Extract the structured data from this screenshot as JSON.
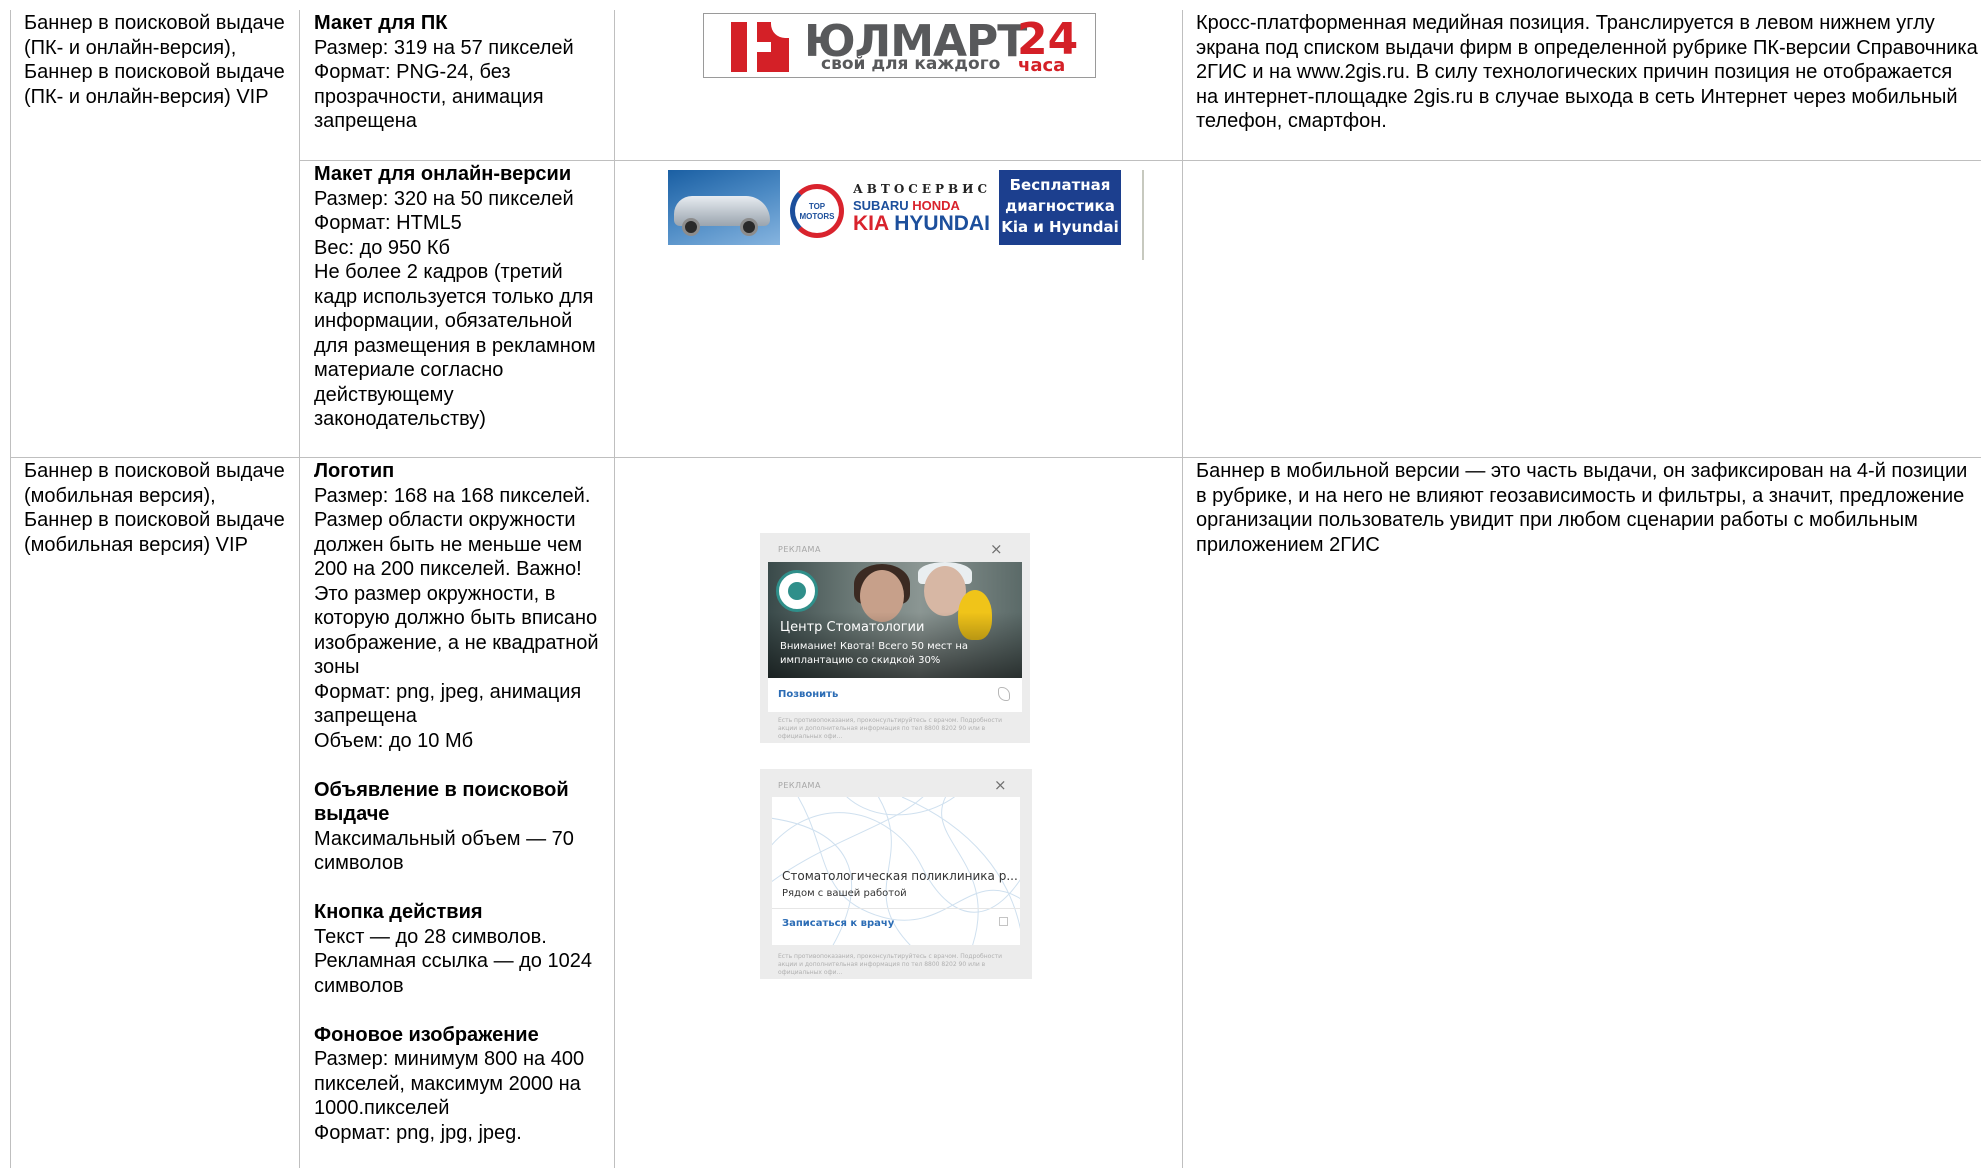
{
  "rows": [
    {
      "placement": "Баннер в поисковой выдаче (ПК- и онлайн-версия), Баннер в поисковой выдаче (ПК- и онлайн-версия) VIP",
      "specs": [
        {
          "title": "Макет для ПК",
          "lines": [
            "Размер: 319 на 57 пикселей",
            "Формат: PNG-24, без прозрачности, анимация запрещена"
          ],
          "banner": {
            "brand": "ЮЛМАРТ",
            "number": "24",
            "tagline": "свой для каждого",
            "tagline_suffix": "часа",
            "colors": {
              "brand_red": "#d42027",
              "brand_gray": "#58595b"
            }
          }
        },
        {
          "title": "Макет для онлайн-версии",
          "lines": [
            "Размер: 320 на 50 пикселей",
            "Формат: HTML5",
            "Вес: до 950 Кб",
            "Не более 2 кадров (третий кадр используется только для информации, обязательной для размещения в рекламном материале согласно действующему законодательству)"
          ],
          "banner": {
            "logo_text": "TOP MOTORS",
            "line1": "АВТОСЕРВИС",
            "brand_a": "SUBARU",
            "brand_b": "HONDA",
            "brand_c": "KIA",
            "brand_d": "HYUNDAI",
            "promo": [
              "Бесплатная",
              "диагностика",
              "Kia и Hyundai"
            ],
            "colors": {
              "blue": "#1c3f8e",
              "red": "#d9232d"
            }
          }
        }
      ],
      "description": "Кросс-платформенная медийная позиция. Транслируется в левом нижнем углу экрана под списком выдачи фирм в определенной рубрике ПК-версии Справочника 2ГИС и на www.2gis.ru. В силу технологических причин позиция не отображается на интернет-площадке 2gis.ru в случае выхода в сеть Интернет через мобильный телефон, смартфон."
    },
    {
      "placement": "Баннер в поисковой выдаче (мобильная версия), Баннер в поисковой выдаче (мобильная версия) VIP",
      "specs": [
        {
          "title": "Логотип",
          "lines": [
            "Размер: 168 на 168 пикселей. Размер области окружности должен быть не меньше чем 200 на 200 пикселей. Важно! Это размер окружности, в которую должно быть вписано изображение, а не квадратной зоны",
            "Формат: png, jpeg, анимация запрещена",
            "Объем: до 10 Мб"
          ]
        },
        {
          "title": "Объявление в поисковой выдаче",
          "lines": [
            "Максимальный объем — 70 символов"
          ]
        },
        {
          "title": "Кнопка действия",
          "lines": [
            "Текст — до 28 символов.",
            "Рекламная ссылка — до 1024 символов"
          ]
        },
        {
          "title": "Фоновое изображение",
          "lines": [
            "Размер: минимум 800 на 400 пикселей, максимум 2000 на 1000.пикселей",
            "Формат: png, jpg, jpeg."
          ]
        }
      ],
      "cards": [
        {
          "label": "РЕКЛАМА",
          "title": "Центр Стоматологии",
          "subtitle": "Внимание! Квота! Всего 50 мест на имплантацию со скидкой 30%",
          "action": "Позвонить",
          "fine_print": "Есть противопоказания, проконсультируйтесь с врачом. Подробности акции и дополнительная информация по тел 8800 8202 90 или в официальных офи..."
        },
        {
          "label": "РЕКЛАМА",
          "title": "Стоматологическая поликлиника р...",
          "subtitle": "Рядом с вашей работой",
          "action": "Записаться к врачу",
          "fine_print": "Есть противопоказания, проконсультируйтесь с врачом. Подробности акции и дополнительная информация по тел 8800 8202 90 или в официальных офи..."
        }
      ],
      "description": "Баннер в мобильной версии — это часть выдачи, он зафиксирован на 4-й позиции в рубрике, и на него не влияют геозависимость и фильтры, а значит, предложение организации пользователь увидит при любом сценарии работы с мобильным приложением 2ГИС"
    }
  ],
  "colors": {
    "grid": "#bfbfbf",
    "link_blue": "#2b6cb5"
  }
}
